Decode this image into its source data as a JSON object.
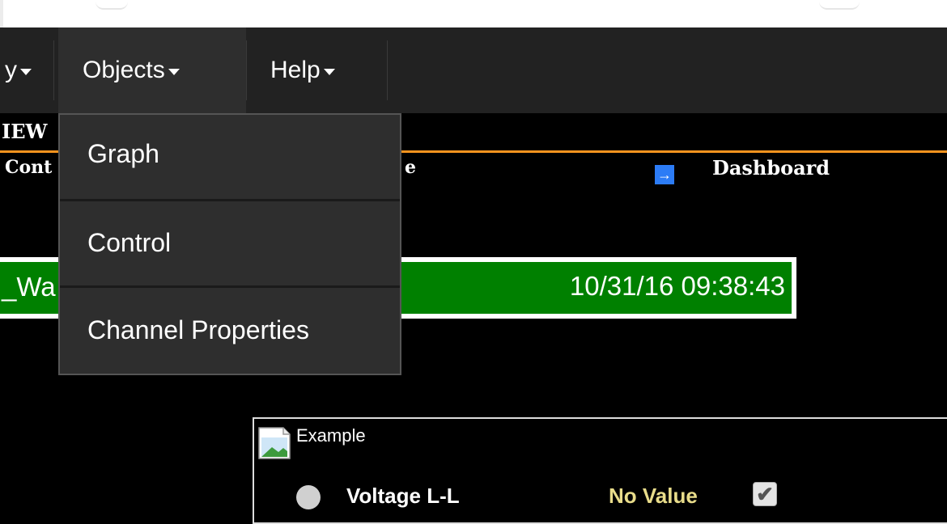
{
  "nav": {
    "partial_label": "y",
    "objects_label": "Objects",
    "help_label": "Help"
  },
  "objects_menu": {
    "items": [
      {
        "label": "Graph"
      },
      {
        "label": "Control"
      },
      {
        "label": "Channel Properties"
      }
    ]
  },
  "header": {
    "view_fragment": "IEW",
    "cont_fragment": "Cont",
    "e_fragment": "e",
    "dashboard_label": "Dashboard"
  },
  "status": {
    "name_fragment": "_Wa",
    "timestamp": "10/31/16 09:38:43",
    "bg_color": "#008000"
  },
  "example": {
    "title": "Example",
    "channel_label": "Voltage L-L",
    "channel_value": "No Value",
    "checkbox_checked": true
  },
  "colors": {
    "accent_line": "#f7931e",
    "navbar": "#222222",
    "dashboard_arrow": "#2c7cf6"
  },
  "icons": {
    "dashboard_arrow": "arrow-right-icon",
    "example_image": "broken-image-icon",
    "status_dot": "status-dot-icon",
    "checkbox": "checkmark-icon"
  }
}
